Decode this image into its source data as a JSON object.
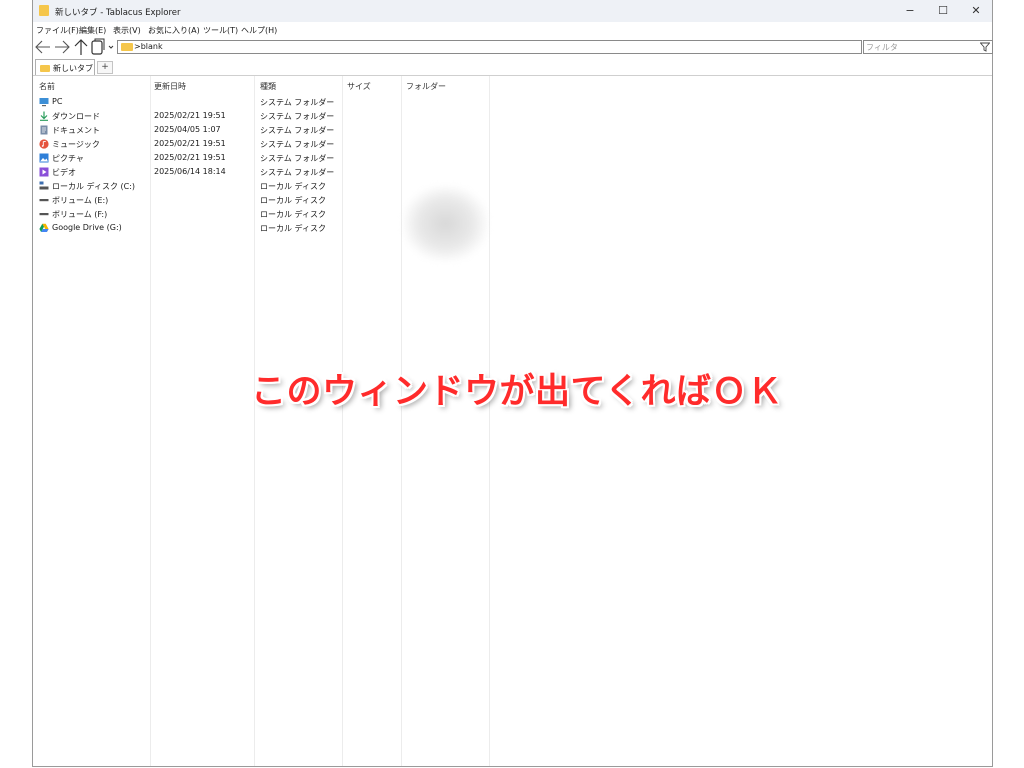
{
  "window": {
    "title": "新しいタブ - Tablacus Explorer",
    "minimize": "−",
    "maximize": "☐",
    "close": "✕"
  },
  "menu": [
    {
      "label": "ファイル(F)"
    },
    {
      "label": "編集(E)"
    },
    {
      "label": "表示(V)"
    },
    {
      "label": "お気に入り(A)"
    },
    {
      "label": "ツール(T)"
    },
    {
      "label": "ヘルプ(H)"
    }
  ],
  "address": {
    "path": ">blank",
    "filter_placeholder": "フィルタ"
  },
  "tabs": [
    {
      "label": "新しいタブ"
    }
  ],
  "tab_add": "+",
  "columns": [
    "名前",
    "更新日時",
    "種類",
    "サイズ",
    "フォルダー"
  ],
  "rows": [
    {
      "name": "PC",
      "date": "",
      "type": "システム フォルダー",
      "icon": "pc-icon",
      "color": "#3d8fd6"
    },
    {
      "name": "ダウンロード",
      "date": "2025/02/21 19:51",
      "type": "システム フォルダー",
      "icon": "download-icon",
      "color": "#2a9d5c"
    },
    {
      "name": "ドキュメント",
      "date": "2025/04/05 1:07",
      "type": "システム フォルダー",
      "icon": "document-icon",
      "color": "#7a8ea8"
    },
    {
      "name": "ミュージック",
      "date": "2025/02/21 19:51",
      "type": "システム フォルダー",
      "icon": "music-icon",
      "color": "#e5533d"
    },
    {
      "name": "ピクチャ",
      "date": "2025/02/21 19:51",
      "type": "システム フォルダー",
      "icon": "pictures-icon",
      "color": "#2f7fd8"
    },
    {
      "name": "ビデオ",
      "date": "2025/06/14 18:14",
      "type": "システム フォルダー",
      "icon": "video-icon",
      "color": "#8a4fd8"
    },
    {
      "name": "ローカル ディスク (C:)",
      "date": "",
      "type": "ローカル ディスク",
      "icon": "local-disk-icon",
      "color": "#3d6fb0"
    },
    {
      "name": "ボリューム (E:)",
      "date": "",
      "type": "ローカル ディスク",
      "icon": "drive-icon",
      "color": "#555555"
    },
    {
      "name": "ボリューム (F:)",
      "date": "",
      "type": "ローカル ディスク",
      "icon": "drive-icon",
      "color": "#555555"
    },
    {
      "name": "Google Drive (G:)",
      "date": "",
      "type": "ローカル ディスク",
      "icon": "google-drive-icon",
      "color": "#f4b400"
    }
  ],
  "annotation": "このウィンドウが出てくればＯＫ"
}
